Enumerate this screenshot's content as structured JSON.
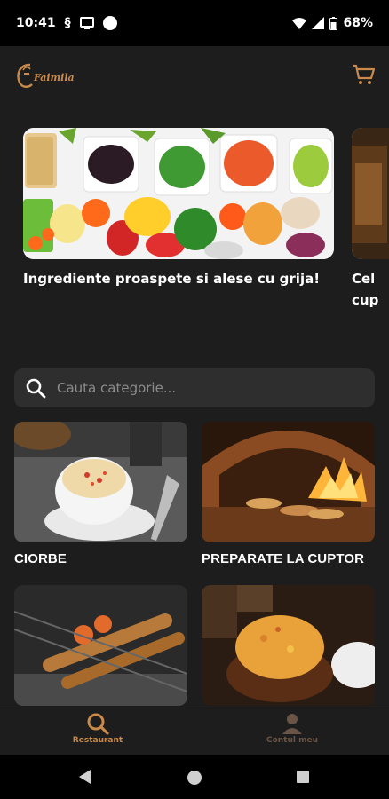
{
  "status": {
    "time": "10:41",
    "battery": "68%"
  },
  "header": {
    "brand": "Faimila"
  },
  "banners": [
    {
      "caption": "Ingrediente proaspete si alese cu grija!"
    },
    {
      "caption": "Cel cup"
    }
  ],
  "search": {
    "placeholder": "Cauta categorie..."
  },
  "categories": [
    {
      "title": "CIORBE"
    },
    {
      "title": "PREPARATE LA CUPTOR"
    },
    {
      "title": ""
    },
    {
      "title": ""
    }
  ],
  "nav": {
    "items": [
      {
        "label": "Restaurant",
        "active": true
      },
      {
        "label": "Contul meu",
        "active": false
      }
    ]
  },
  "colors": {
    "accent": "#c98a4b",
    "background": "#1d1d1d",
    "surface": "#2e2e2e"
  }
}
